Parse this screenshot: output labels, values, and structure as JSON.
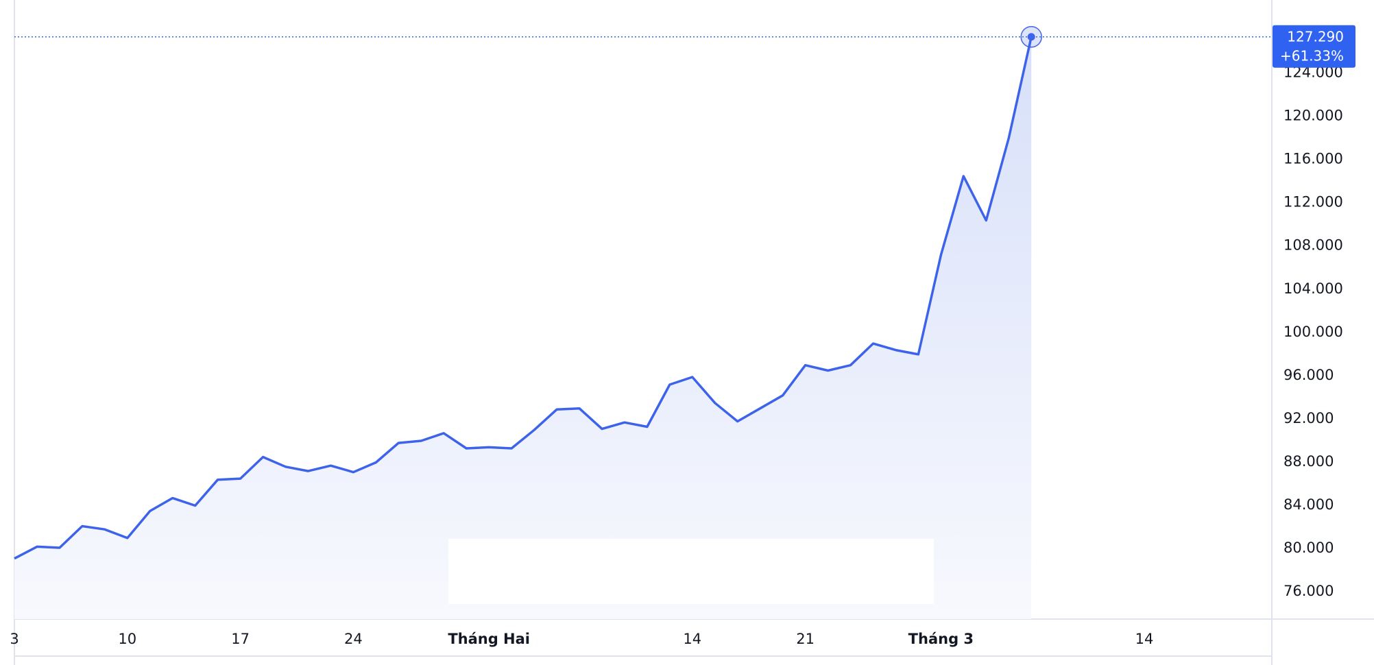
{
  "chart_data": {
    "type": "area",
    "x": [
      "01-03",
      "01-06",
      "01-07",
      "01-08",
      "01-09",
      "01-10",
      "01-13",
      "01-14",
      "01-15",
      "01-16",
      "01-17",
      "01-20",
      "01-21",
      "01-22",
      "01-23",
      "01-24",
      "01-27",
      "01-28",
      "01-29",
      "01-30",
      "01-31",
      "02-03",
      "02-04",
      "02-05",
      "02-06",
      "02-07",
      "02-10",
      "02-11",
      "02-12",
      "02-13",
      "02-14",
      "02-17",
      "02-18",
      "02-19",
      "02-20",
      "02-21",
      "02-24",
      "02-25",
      "02-26",
      "02-27",
      "02-28",
      "03-03",
      "03-04",
      "03-05",
      "03-06",
      "03-07"
    ],
    "series": [
      {
        "values": [
          79.0,
          80.1,
          80.0,
          82.0,
          81.7,
          80.9,
          83.4,
          84.6,
          83.9,
          86.3,
          86.4,
          88.4,
          87.5,
          87.1,
          87.6,
          87.0,
          87.9,
          89.7,
          89.9,
          90.6,
          89.2,
          89.3,
          89.2,
          90.9,
          92.8,
          92.9,
          91.0,
          91.6,
          91.2,
          95.1,
          95.8,
          93.4,
          91.7,
          92.9,
          94.1,
          96.9,
          96.4,
          96.9,
          98.9,
          98.3,
          97.9,
          107.1,
          114.4,
          110.3,
          117.9,
          127.29
        ]
      }
    ],
    "x_tick_labels": [
      {
        "label": "3",
        "x": "01-03"
      },
      {
        "label": "10",
        "x": "01-10"
      },
      {
        "label": "17",
        "x": "01-17"
      },
      {
        "label": "24",
        "x": "01-24"
      },
      {
        "label": "Tháng Hai",
        "x": "02-03",
        "bold": true
      },
      {
        "label": "14",
        "x": "02-14"
      },
      {
        "label": "21",
        "x": "02-21"
      },
      {
        "label": "Tháng 3",
        "x": "03-03",
        "bold": true
      },
      {
        "label": "14",
        "x": "03-14"
      }
    ],
    "y_ticks": [
      "76.000",
      "80.000",
      "84.000",
      "88.000",
      "92.000",
      "96.000",
      "100.000",
      "104.000",
      "108.000",
      "112.000",
      "116.000",
      "120.000",
      "124.000"
    ],
    "ylim": [
      73.4,
      130.7
    ],
    "last_value_label": "127.290",
    "last_change_label": "+61.33%",
    "grid": false,
    "colors": {
      "line": "#3d63ea",
      "fill_top": "#d7e0f9",
      "fill_bottom": "#f8f9fe",
      "tag_bg": "#2f62f1",
      "axis_line": "#e0e3eb",
      "text": "#131722"
    }
  }
}
